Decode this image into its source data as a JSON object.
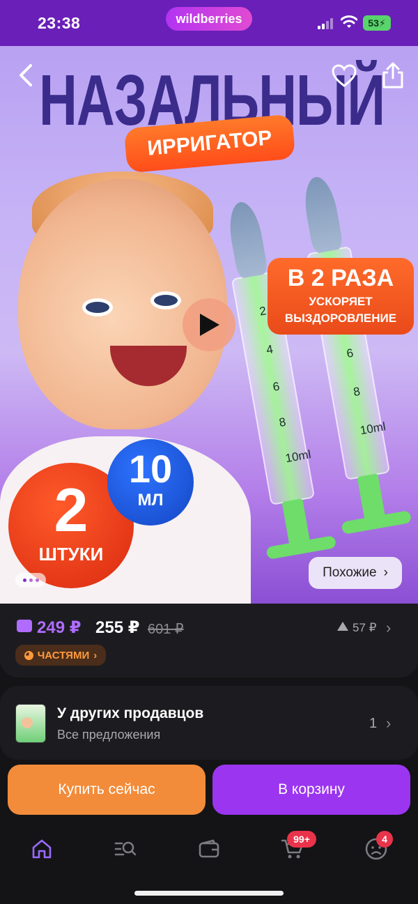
{
  "status_bar": {
    "time": "23:38",
    "brand": "wildberries",
    "battery": "53"
  },
  "hero": {
    "title": "НАЗАЛЬНЫЙ",
    "subtitle": "ИРРИГАТОР",
    "speed_badge": {
      "big": "В 2 РАЗА",
      "line1": "УСКОРЯЕТ",
      "line2": "ВЫЗДОРОВЛЕНИЕ"
    },
    "count_badge": {
      "num": "2",
      "unit": "ШТУКИ"
    },
    "volume_badge": {
      "num": "10",
      "unit": "МЛ"
    },
    "syringe_marks_front": [
      "2",
      "4",
      "6",
      "8",
      "10ml"
    ],
    "syringe_marks_back": [
      "6",
      "8",
      "10ml"
    ],
    "similar_label": "Похожие"
  },
  "price": {
    "wallet_price": "249 ₽",
    "price": "255 ₽",
    "old_price": "601 ₽",
    "delta": "57 ₽",
    "installments": "ЧАСТЯМИ"
  },
  "sellers": {
    "title": "У других продавцов",
    "subtitle": "Все предложения",
    "count": "1"
  },
  "actions": {
    "buy_now": "Купить сейчас",
    "add_to_cart": "В корзину"
  },
  "tab_bar": {
    "tabs": [
      "home-icon",
      "catalog-search-icon",
      "wallet-icon",
      "cart-icon",
      "profile-icon"
    ],
    "cart_badge": "99+",
    "profile_badge": "4"
  },
  "colors": {
    "status_bar": "#6a1fb8",
    "accent_purple": "#9b35f0",
    "buy_orange": "#f28c3a",
    "wallet_price": "#b06cff",
    "badge_red": "#e8334a"
  }
}
